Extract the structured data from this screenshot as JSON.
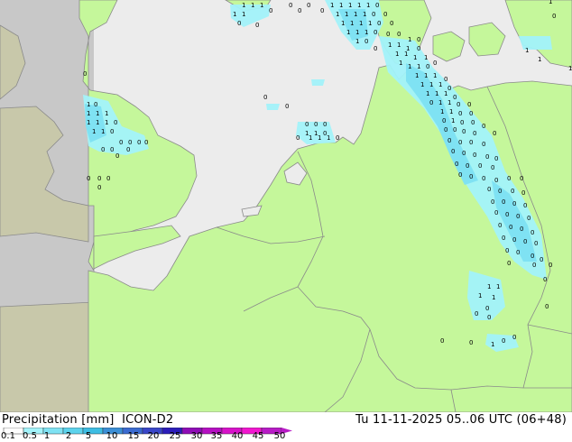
{
  "title": {
    "left": "Precipitation [mm]  ICON-D2",
    "right": "Tu 11-11-2025 05..06 UTC (06+48)"
  },
  "colorscale": {
    "labels": [
      "0.1",
      "0.5",
      "1",
      "2",
      "5",
      "10",
      "15",
      "20",
      "25",
      "30",
      "35",
      "40",
      "45",
      "50"
    ],
    "colors": [
      "#fefefe",
      "#a3f3fa",
      "#7fe2f3",
      "#5cd3ec",
      "#3dbde3",
      "#3b8fd6",
      "#3a6ad0",
      "#3946c8",
      "#2b1cb9",
      "#8f0cb6",
      "#b50fc2",
      "#d712c9",
      "#f116cf",
      "#b81bc6"
    ]
  },
  "map_colors": {
    "land": "#c5f79b",
    "sea": "#ececec",
    "outside_domain": "#c8c8c8",
    "outside_land": "#c8c8aa",
    "precip_light": "#a3f3fa",
    "precip_medium": "#7fe2f3",
    "border": "#8a8a8a"
  }
}
